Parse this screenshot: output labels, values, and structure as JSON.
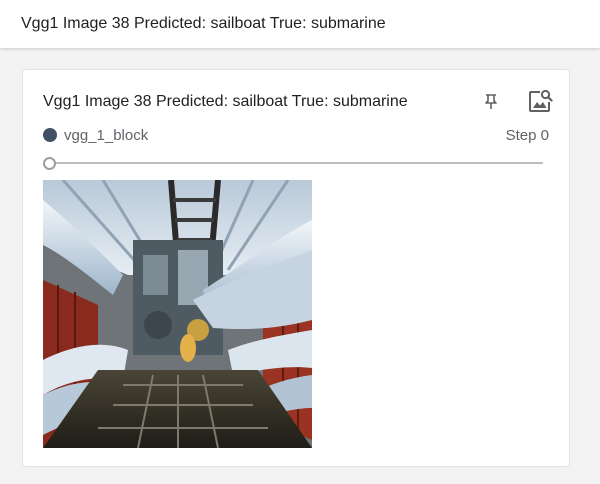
{
  "header": {
    "title": "Vgg1 Image 38 Predicted: sailboat True: submarine"
  },
  "card": {
    "title": "Vgg1 Image 38 Predicted: sailboat True: submarine",
    "pin_icon": "pin-icon",
    "image_search_icon": "image-search-icon",
    "run": {
      "name": "vgg_1_block",
      "color": "#425066"
    },
    "step_label": "Step 0",
    "slider": {
      "value": 0
    },
    "image": {
      "icon": "submarine-interior-photo"
    }
  }
}
